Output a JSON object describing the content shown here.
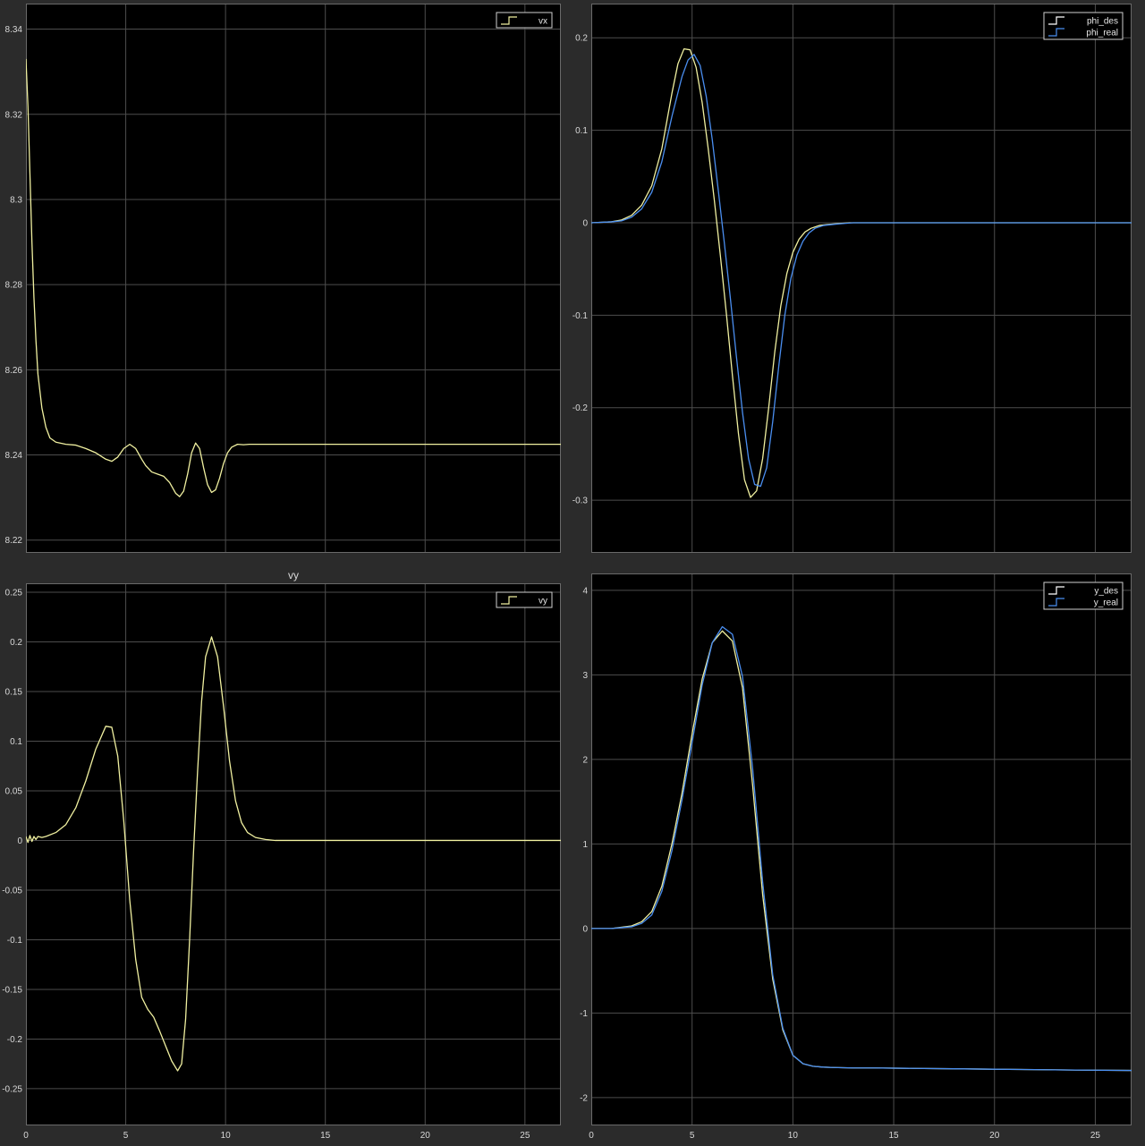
{
  "background_color": "#2b2b2b",
  "plot_background": "#000000",
  "grid_color": "#4d4d4d",
  "tick_color": "#d8d8d8",
  "chart_data": [
    {
      "type": "line",
      "title": "",
      "xlim": [
        0,
        26.8
      ],
      "ylim": [
        8.217,
        8.346
      ],
      "xticks": [],
      "xticklabels": [],
      "yticks": [
        8.22,
        8.24,
        8.26,
        8.28,
        8.3,
        8.32,
        8.34
      ],
      "yticklabels": [
        "8.22",
        "8.24",
        "8.26",
        "8.28",
        "8.3",
        "8.32",
        "8.34"
      ],
      "grid": true,
      "legend_position": "top-right",
      "series": [
        {
          "name": "vx",
          "color": "#f0f0a0",
          "x": [
            0,
            0.1,
            0.2,
            0.3,
            0.4,
            0.5,
            0.6,
            0.8,
            1.0,
            1.2,
            1.5,
            2.0,
            2.5,
            3.0,
            3.5,
            4.0,
            4.3,
            4.6,
            4.9,
            5.2,
            5.5,
            5.8,
            6.0,
            6.3,
            6.6,
            6.9,
            7.2,
            7.5,
            7.7,
            7.9,
            8.1,
            8.3,
            8.5,
            8.7,
            8.9,
            9.1,
            9.3,
            9.5,
            9.7,
            9.9,
            10.1,
            10.3,
            10.6,
            10.9,
            11.2,
            12,
            14,
            16,
            18,
            20,
            22,
            24,
            26.8
          ],
          "y": [
            8.333,
            8.322,
            8.306,
            8.29,
            8.277,
            8.267,
            8.259,
            8.251,
            8.2465,
            8.244,
            8.243,
            8.2425,
            8.2423,
            8.2415,
            8.2405,
            8.239,
            8.2385,
            8.2395,
            8.2415,
            8.2425,
            8.2415,
            8.239,
            8.2375,
            8.236,
            8.2355,
            8.235,
            8.2335,
            8.231,
            8.2302,
            8.2315,
            8.2355,
            8.2405,
            8.2428,
            8.2415,
            8.237,
            8.233,
            8.2312,
            8.2318,
            8.2345,
            8.238,
            8.2405,
            8.2418,
            8.2425,
            8.2424,
            8.2425,
            8.2425,
            8.2425,
            8.2425,
            8.2425,
            8.2425,
            8.2425,
            8.2425,
            8.2425
          ]
        }
      ]
    },
    {
      "type": "line",
      "title": "",
      "xlim": [
        0,
        26.8
      ],
      "ylim": [
        -0.357,
        0.237
      ],
      "xticks": [],
      "xticklabels": [],
      "yticks": [
        -0.3,
        -0.2,
        -0.1,
        0,
        0.1,
        0.2
      ],
      "yticklabels": [
        "-0.3",
        "-0.2",
        "-0.1",
        "0",
        "0.1",
        "0.2"
      ],
      "grid": true,
      "legend_position": "top-right",
      "series": [
        {
          "name": "phi_des",
          "color": "#f0f0a0",
          "x": [
            0,
            1.0,
            1.5,
            2.0,
            2.5,
            3.0,
            3.5,
            4.0,
            4.3,
            4.6,
            4.9,
            5.2,
            5.5,
            5.8,
            6.1,
            6.4,
            6.7,
            7.0,
            7.3,
            7.6,
            7.9,
            8.2,
            8.5,
            8.8,
            9.1,
            9.4,
            9.7,
            10.0,
            10.3,
            10.6,
            10.9,
            11.3,
            11.7,
            12.2,
            12.8,
            14,
            16,
            18,
            20,
            22,
            24,
            26.8
          ],
          "y": [
            0,
            0.001,
            0.003,
            0.008,
            0.019,
            0.04,
            0.08,
            0.14,
            0.172,
            0.188,
            0.187,
            0.168,
            0.13,
            0.08,
            0.025,
            -0.035,
            -0.098,
            -0.165,
            -0.228,
            -0.278,
            -0.297,
            -0.29,
            -0.255,
            -0.2,
            -0.14,
            -0.09,
            -0.055,
            -0.032,
            -0.018,
            -0.01,
            -0.006,
            -0.003,
            -0.002,
            -0.001,
            0,
            0,
            0,
            0,
            0,
            0,
            0,
            0
          ]
        },
        {
          "name": "phi_real",
          "color": "#4a8ef0",
          "x": [
            0,
            1.0,
            1.5,
            2.0,
            2.5,
            3.0,
            3.5,
            4.0,
            4.5,
            4.8,
            5.1,
            5.4,
            5.7,
            6.0,
            6.3,
            6.6,
            6.9,
            7.2,
            7.5,
            7.8,
            8.1,
            8.4,
            8.7,
            9.0,
            9.3,
            9.6,
            9.9,
            10.2,
            10.5,
            10.8,
            11.1,
            11.5,
            11.9,
            12.4,
            13.0,
            14,
            16,
            18,
            20,
            22,
            24,
            26.8
          ],
          "y": [
            0,
            0.001,
            0.002,
            0.006,
            0.015,
            0.033,
            0.066,
            0.115,
            0.158,
            0.176,
            0.182,
            0.17,
            0.137,
            0.09,
            0.035,
            -0.022,
            -0.082,
            -0.145,
            -0.205,
            -0.255,
            -0.283,
            -0.285,
            -0.265,
            -0.215,
            -0.155,
            -0.1,
            -0.06,
            -0.035,
            -0.02,
            -0.011,
            -0.006,
            -0.003,
            -0.002,
            -0.001,
            0,
            0,
            0,
            0,
            0,
            0,
            0,
            0
          ]
        }
      ]
    },
    {
      "type": "line",
      "title": "vy",
      "xlim": [
        0,
        26.8
      ],
      "ylim": [
        -0.287,
        0.259
      ],
      "xticks": [
        0,
        5,
        10,
        15,
        20,
        25
      ],
      "xticklabels": [
        "0",
        "5",
        "10",
        "15",
        "20",
        "25"
      ],
      "yticks": [
        -0.25,
        -0.2,
        -0.15,
        -0.1,
        -0.05,
        0,
        0.05,
        0.1,
        0.15,
        0.2,
        0.25
      ],
      "yticklabels": [
        "-0.25",
        "-0.2",
        "-0.15",
        "-0.1",
        "-0.05",
        "0",
        "0.05",
        "0.1",
        "0.15",
        "0.2",
        "0.25"
      ],
      "grid": true,
      "legend_position": "top-right",
      "series": [
        {
          "name": "vy",
          "color": "#f0f0a0",
          "x": [
            0,
            0.1,
            0.2,
            0.3,
            0.4,
            0.5,
            0.6,
            0.8,
            1.0,
            1.5,
            2.0,
            2.5,
            3.0,
            3.5,
            4.0,
            4.3,
            4.6,
            4.9,
            5.2,
            5.5,
            5.8,
            6.1,
            6.4,
            6.7,
            7.0,
            7.3,
            7.6,
            7.8,
            8.0,
            8.2,
            8.4,
            8.6,
            8.8,
            9.0,
            9.3,
            9.6,
            9.9,
            10.2,
            10.5,
            10.8,
            11.1,
            11.5,
            12.0,
            12.5,
            13.0,
            14,
            16,
            18,
            20,
            22,
            24,
            26.8
          ],
          "y": [
            0.004,
            -0.002,
            0.005,
            -0.001,
            0.004,
            0.001,
            0.004,
            0.003,
            0.004,
            0.008,
            0.016,
            0.033,
            0.06,
            0.092,
            0.115,
            0.114,
            0.085,
            0.02,
            -0.06,
            -0.12,
            -0.158,
            -0.17,
            -0.178,
            -0.192,
            -0.207,
            -0.222,
            -0.232,
            -0.225,
            -0.18,
            -0.1,
            -0.01,
            0.07,
            0.14,
            0.185,
            0.205,
            0.185,
            0.135,
            0.08,
            0.04,
            0.018,
            0.008,
            0.003,
            0.001,
            0,
            0,
            0,
            0,
            0,
            0,
            0,
            0,
            0
          ]
        }
      ]
    },
    {
      "type": "line",
      "title": "",
      "xlim": [
        0,
        26.8
      ],
      "ylim": [
        -2.33,
        4.2
      ],
      "xticks": [
        0,
        5,
        10,
        15,
        20,
        25
      ],
      "xticklabels": [
        "0",
        "5",
        "10",
        "15",
        "20",
        "25"
      ],
      "yticks": [
        -2,
        -1,
        0,
        1,
        2,
        3,
        4
      ],
      "yticklabels": [
        "-2",
        "-1",
        "0",
        "1",
        "2",
        "3",
        "4"
      ],
      "grid": true,
      "legend_position": "top-right",
      "series": [
        {
          "name": "y_des",
          "color": "#f0f0a0",
          "x": [
            0,
            1.0,
            2.0,
            2.5,
            3.0,
            3.5,
            4.0,
            4.5,
            5.0,
            5.5,
            6.0,
            6.5,
            7.0,
            7.5,
            8.0,
            8.5,
            9.0,
            9.5,
            10.0,
            10.5,
            11.0,
            11.5,
            12.0,
            13.0,
            14.0,
            16.0,
            18.0,
            20.0,
            22.0,
            24.0,
            26.8
          ],
          "y": [
            0,
            0,
            0.03,
            0.08,
            0.2,
            0.5,
            1.0,
            1.6,
            2.3,
            2.95,
            3.38,
            3.52,
            3.4,
            2.85,
            1.7,
            0.4,
            -0.6,
            -1.2,
            -1.5,
            -1.6,
            -1.63,
            -1.64,
            -1.645,
            -1.65,
            -1.65,
            -1.655,
            -1.66,
            -1.665,
            -1.67,
            -1.675,
            -1.68
          ]
        },
        {
          "name": "y_real",
          "color": "#4a8ef0",
          "x": [
            0,
            1.0,
            2.0,
            2.5,
            3.0,
            3.5,
            4.0,
            4.5,
            5.0,
            5.5,
            6.0,
            6.5,
            7.0,
            7.5,
            8.0,
            8.5,
            9.0,
            9.5,
            10.0,
            10.5,
            11.0,
            11.5,
            12.0,
            13.0,
            14.0,
            16.0,
            18.0,
            20.0,
            22.0,
            24.0,
            26.8
          ],
          "y": [
            0,
            0,
            0.02,
            0.06,
            0.16,
            0.44,
            0.92,
            1.52,
            2.2,
            2.88,
            3.38,
            3.57,
            3.48,
            2.98,
            1.9,
            0.55,
            -0.55,
            -1.18,
            -1.5,
            -1.6,
            -1.63,
            -1.64,
            -1.645,
            -1.65,
            -1.65,
            -1.655,
            -1.66,
            -1.665,
            -1.67,
            -1.675,
            -1.68
          ]
        }
      ]
    }
  ]
}
